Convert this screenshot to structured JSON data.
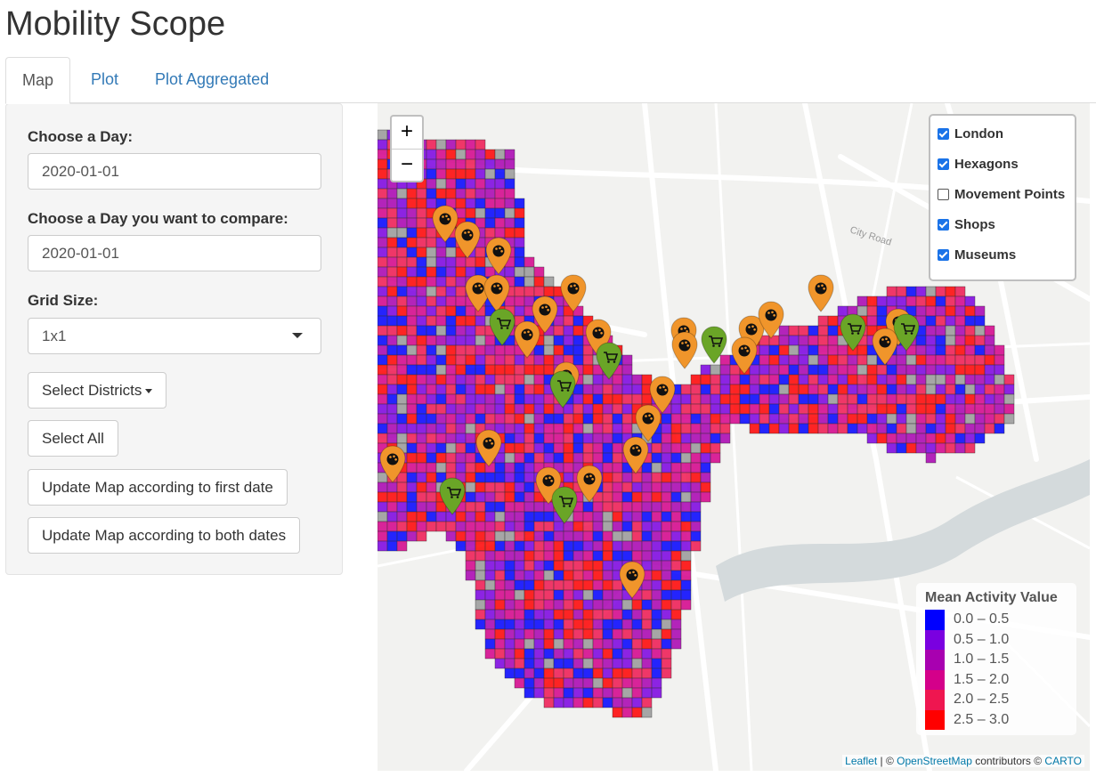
{
  "app": {
    "title": "Mobility Scope"
  },
  "tabs": [
    {
      "label": "Map",
      "active": true
    },
    {
      "label": "Plot",
      "active": false
    },
    {
      "label": "Plot Aggregated",
      "active": false
    }
  ],
  "sidebar": {
    "day_label": "Choose a Day:",
    "day_value": "2020-01-01",
    "compare_label": "Choose a Day you want to compare:",
    "compare_value": "2020-01-01",
    "grid_label": "Grid Size:",
    "grid_value": "1x1",
    "districts_button": "Select Districts",
    "select_all_button": "Select All",
    "update_first_button": "Update Map according to first date",
    "update_both_button": "Update Map according to both dates"
  },
  "map": {
    "zoom_in": "+",
    "zoom_out": "−",
    "street_labels": [
      "City Road"
    ],
    "layers": [
      {
        "label": "London",
        "checked": true
      },
      {
        "label": "Hexagons",
        "checked": true
      },
      {
        "label": "Movement Points",
        "checked": false
      },
      {
        "label": "Shops",
        "checked": true
      },
      {
        "label": "Museums",
        "checked": true
      }
    ],
    "legend": {
      "title": "Mean Activity Value",
      "items": [
        {
          "label": "0.0 – 0.5",
          "color": "#0000ff"
        },
        {
          "label": "0.5 – 1.0",
          "color": "#7a00e0"
        },
        {
          "label": "1.0 – 1.5",
          "color": "#a800b0"
        },
        {
          "label": "1.5 – 2.0",
          "color": "#d4008a"
        },
        {
          "label": "2.0 – 2.5",
          "color": "#ef1650"
        },
        {
          "label": "2.5 – 3.0",
          "color": "#ff0000"
        }
      ]
    },
    "attribution": {
      "leaflet": "Leaflet",
      "sep1": " | © ",
      "osm": "OpenStreetMap",
      "middle": " contributors © ",
      "carto": "CARTO"
    },
    "marker_colors": {
      "museum": "#f0952b",
      "shop": "#6aa527"
    }
  }
}
